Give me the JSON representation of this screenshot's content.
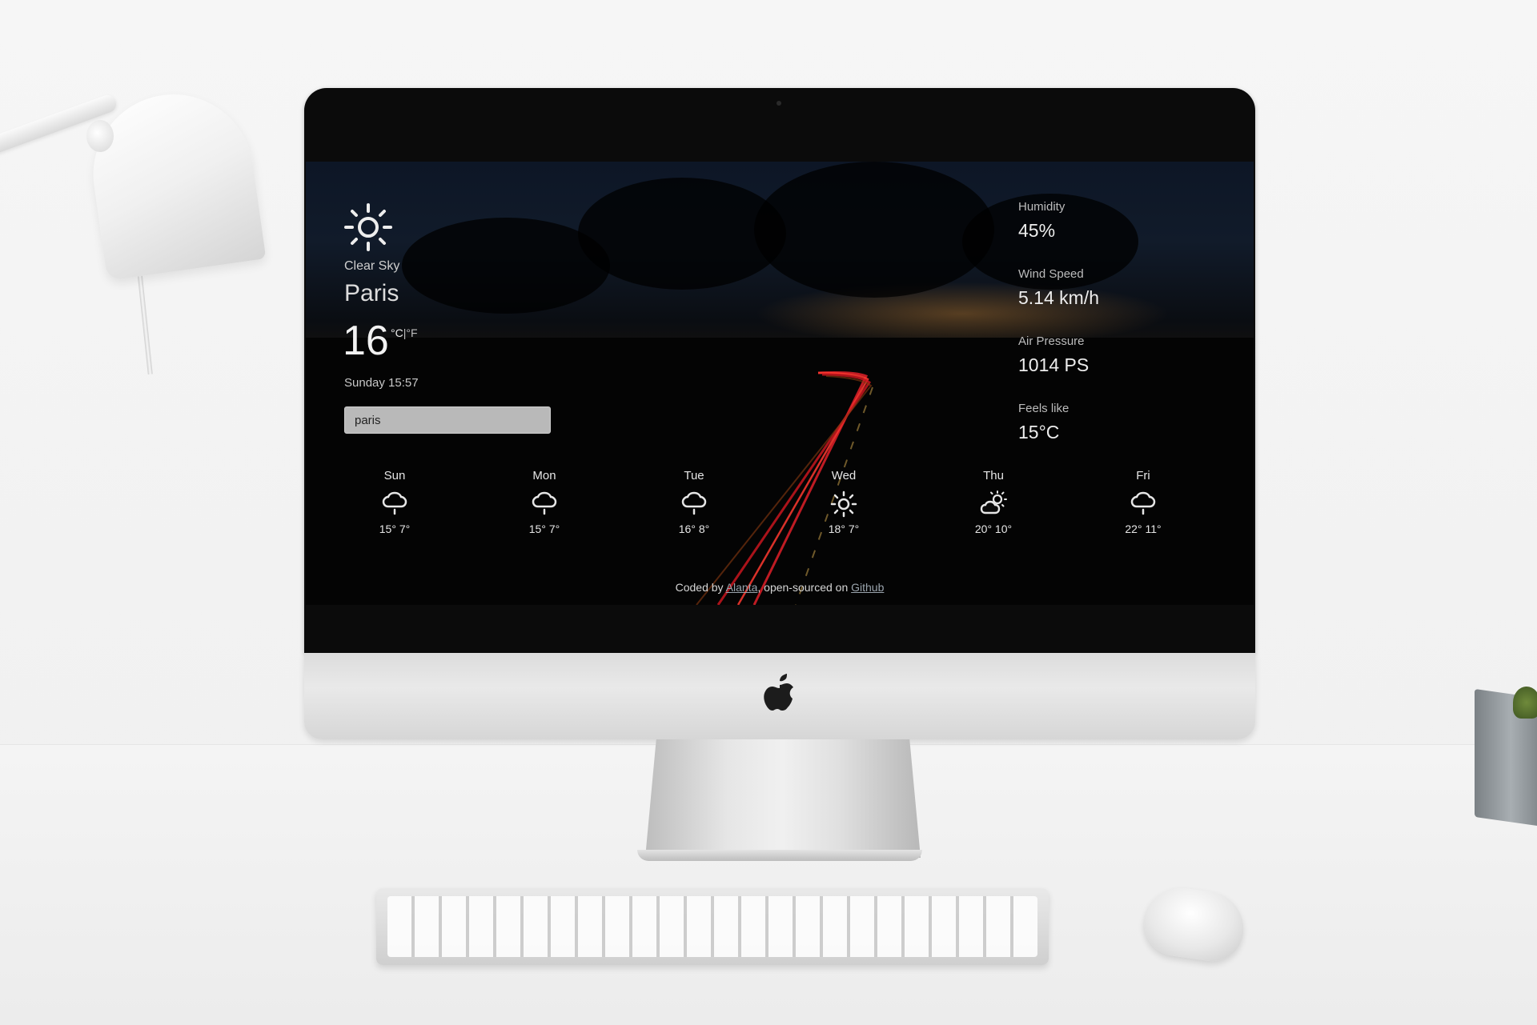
{
  "current": {
    "condition": "Clear Sky",
    "city": "Paris",
    "temperature": "16",
    "unit_celsius": "°C",
    "unit_separator": "|",
    "unit_fahrenheit": "°F",
    "datetime": "Sunday 15:57",
    "icon": "sun-icon"
  },
  "search": {
    "value": "paris"
  },
  "stats": [
    {
      "label": "Humidity",
      "value": "45%"
    },
    {
      "label": "Wind Speed",
      "value": "5.14 km/h"
    },
    {
      "label": "Air Pressure",
      "value": "1014 PS"
    },
    {
      "label": "Feels like",
      "value": "15°C"
    }
  ],
  "forecast": [
    {
      "day": "Sun",
      "range": "15° 7°",
      "icon": "rain-icon"
    },
    {
      "day": "Mon",
      "range": "15° 7°",
      "icon": "rain-icon"
    },
    {
      "day": "Tue",
      "range": "16° 8°",
      "icon": "rain-icon"
    },
    {
      "day": "Wed",
      "range": "18° 7°",
      "icon": "sun-icon"
    },
    {
      "day": "Thu",
      "range": "20° 10°",
      "icon": "partly-cloudy-icon"
    },
    {
      "day": "Fri",
      "range": "22° 11°",
      "icon": "rain-icon"
    }
  ],
  "footer": {
    "prefix": "Coded by ",
    "author": "Alanta",
    "middle": ", open-sourced on ",
    "repo": "Github"
  },
  "colors": {
    "accent_text": "#e6e6e6",
    "search_bg": "#b9b9b9",
    "road_lights": "#e0202a"
  }
}
